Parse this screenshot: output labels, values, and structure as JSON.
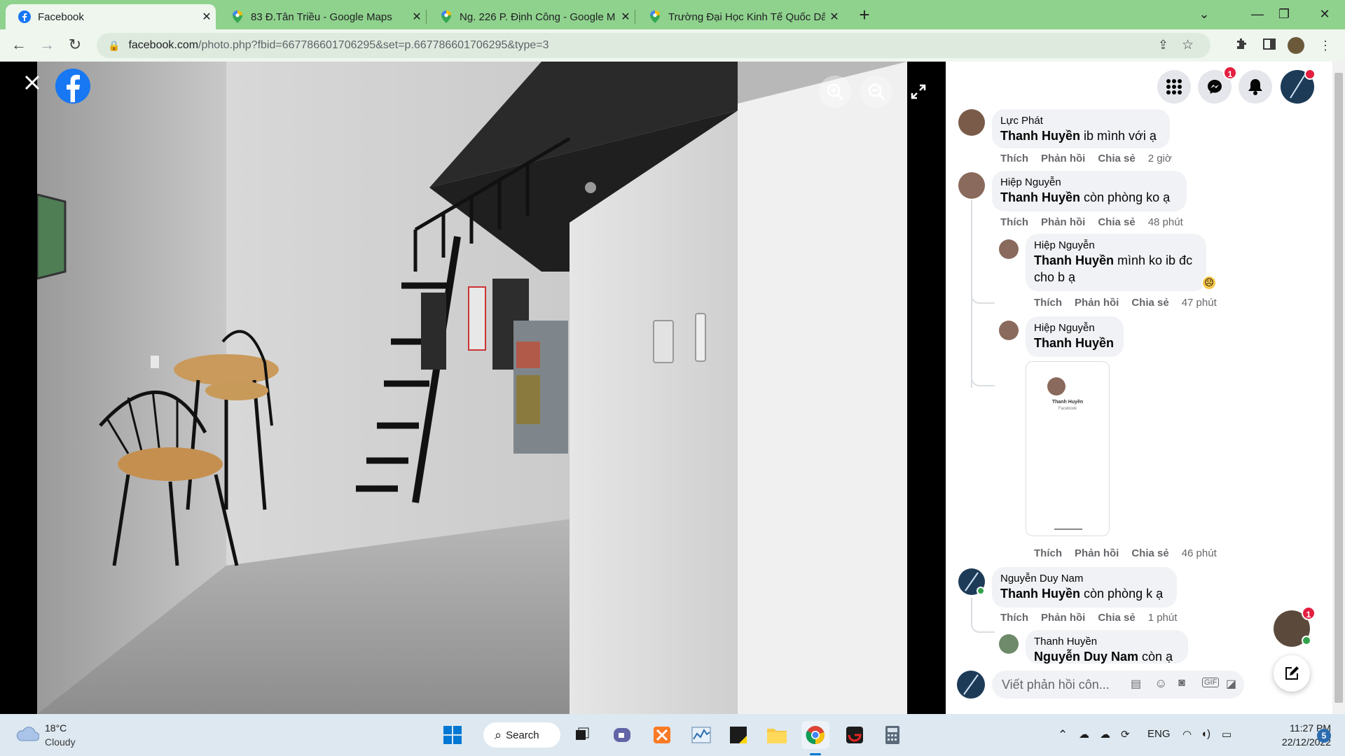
{
  "browser": {
    "tabs": [
      {
        "title": "Facebook",
        "active": true
      },
      {
        "title": "83 Đ.Tân Triều - Google Maps",
        "active": false
      },
      {
        "title": "Ng. 226 P. Định Công - Google M",
        "active": false
      },
      {
        "title": "Trường Đại Học Kinh Tế Quốc Dâ",
        "active": false
      }
    ],
    "new_tab": "+",
    "url_host": "facebook.com",
    "url_path": "/photo.php?fbid=667786601706295&set=p.667786601706295&type=3"
  },
  "viewer": {
    "close_icon": "close-icon",
    "logo": "facebook-logo",
    "zoom_in_icon": "zoom-in-icon",
    "zoom_out_icon": "zoom-out-icon",
    "fullscreen_icon": "fullscreen-icon"
  },
  "panel": {
    "messenger_badge": "1",
    "chat_head_badge": "1",
    "comments": [
      {
        "name": "Lực Phát",
        "mention": "Thanh Huyền",
        "text": " ib mình với ạ",
        "like": "Thích",
        "reply": "Phản hồi",
        "share": "Chia sẻ",
        "time": "2 giờ"
      },
      {
        "name": "Hiệp Nguyễn",
        "mention": "Thanh Huyền",
        "text": " còn phòng ko ạ",
        "like": "Thích",
        "reply": "Phản hồi",
        "share": "Chia sẻ",
        "time": "48 phút"
      },
      {
        "name": "Hiệp Nguyễn",
        "mention": "Thanh Huyền",
        "text": " mình ko ib đc",
        "text2": "cho b ạ",
        "like": "Thích",
        "reply": "Phản hồi",
        "share": "Chia sẻ",
        "time": "47 phút"
      },
      {
        "name": "Hiệp Nguyễn",
        "mention": "Thanh Huyền",
        "text": "",
        "like": "Thích",
        "reply": "Phản hồi",
        "share": "Chia sẻ",
        "time": "46 phút"
      },
      {
        "name": "Nguyễn Duy Nam",
        "mention": "Thanh Huyền",
        "text": " còn phòng k ạ",
        "like": "Thích",
        "reply": "Phản hồi",
        "share": "Chia sẻ",
        "time": "1 phút"
      },
      {
        "name": "Thanh Huyền",
        "mention": "Nguyễn Duy Nam",
        "text": " còn ạ"
      }
    ],
    "screenshot_attachment": {
      "name": "Thanh Huyền",
      "sub": "Facebook"
    },
    "reply_placeholder": "Viết phản hồi côn..."
  },
  "taskbar": {
    "weather_temp": "18°C",
    "weather_desc": "Cloudy",
    "search_label": "Search",
    "lang": "ENG",
    "time": "11:27 PM",
    "date": "22/12/2022",
    "notif_count": "5"
  },
  "colors": {
    "accent": "#1877f2",
    "tab_bar": "#8fd28d",
    "badge": "#e41e3f"
  }
}
